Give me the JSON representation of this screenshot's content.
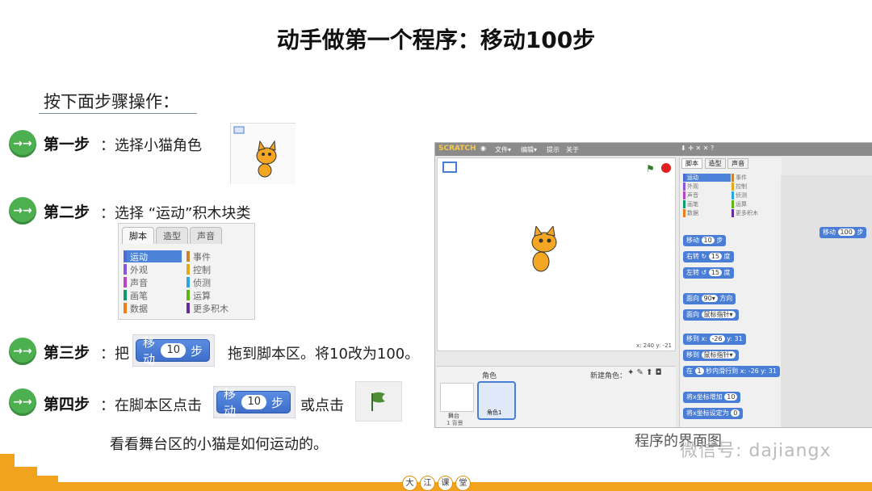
{
  "title": "动手做第一个程序：移动100步",
  "intro": "按下面步骤操作：",
  "step_icon": "→→",
  "steps": [
    {
      "label": "第一步",
      "text": "：选择小猫角色"
    },
    {
      "label": "第二步",
      "text": "：选择 “运动”积木块类"
    },
    {
      "label": "第三步",
      "text_before": "：把",
      "text_after": "拖到脚本区。将10改为100。"
    },
    {
      "label": "第四步",
      "text_before": "：在脚本区点击",
      "text_after": "或点击"
    }
  ],
  "step4_line2": "看看舞台区的小猫是如何运动的。",
  "motion_block": {
    "label": "移动",
    "value": "10",
    "unit": "步"
  },
  "palette": {
    "tabs": [
      "脚本",
      "造型",
      "声音"
    ],
    "left": [
      "运动",
      "外观",
      "声音",
      "画笔",
      "数据"
    ],
    "right": [
      "事件",
      "控制",
      "侦测",
      "运算",
      "更多积木"
    ]
  },
  "scratch": {
    "menu": [
      "文件▾",
      "编辑▾",
      "提示",
      "关于"
    ],
    "tabs": [
      "脚本",
      "造型",
      "声音"
    ],
    "coords": "x: 240  y: -21",
    "sprites_label": "角色",
    "new_sprite": "新建角色：",
    "stage_label": "舞台",
    "stage_sub": "1 背景",
    "sprite_name": "角色1",
    "palette_left": [
      "运动",
      "外观",
      "声音",
      "画笔",
      "数据"
    ],
    "palette_right": [
      "事件",
      "控制",
      "侦测",
      "运算",
      "更多积木"
    ],
    "blocks": [
      {
        "text": "移动",
        "n": "10",
        "u": "步"
      },
      {
        "text": "右转 ↻",
        "n": "15",
        "u": "度"
      },
      {
        "text": "左转 ↺",
        "n": "15",
        "u": "度"
      },
      {
        "text": "面向",
        "n": "90▾",
        "u": "方向"
      },
      {
        "text": "面向",
        "n": "鼠标指针▾",
        "u": ""
      },
      {
        "text": "移到 x:",
        "n": "-26",
        "u": "y: 31"
      },
      {
        "text": "移到",
        "n": "鼠标指针▾",
        "u": ""
      },
      {
        "text": "在",
        "n": "1",
        "u": "秒内滑行到 x: -26 y: 31"
      },
      {
        "text": "将x坐标增加",
        "n": "10",
        "u": ""
      },
      {
        "text": "将x坐标设定为",
        "n": "0",
        "u": ""
      }
    ],
    "script_block": {
      "text": "移动",
      "n": "100",
      "u": "步"
    }
  },
  "caption": "程序的界面图",
  "watermark": "微信号: dajiangx",
  "brand": [
    "大",
    "江",
    "课",
    "堂"
  ],
  "colors": {
    "accent": "#f2a31d",
    "green": "#4caf50",
    "block": "#4a7ed6"
  }
}
